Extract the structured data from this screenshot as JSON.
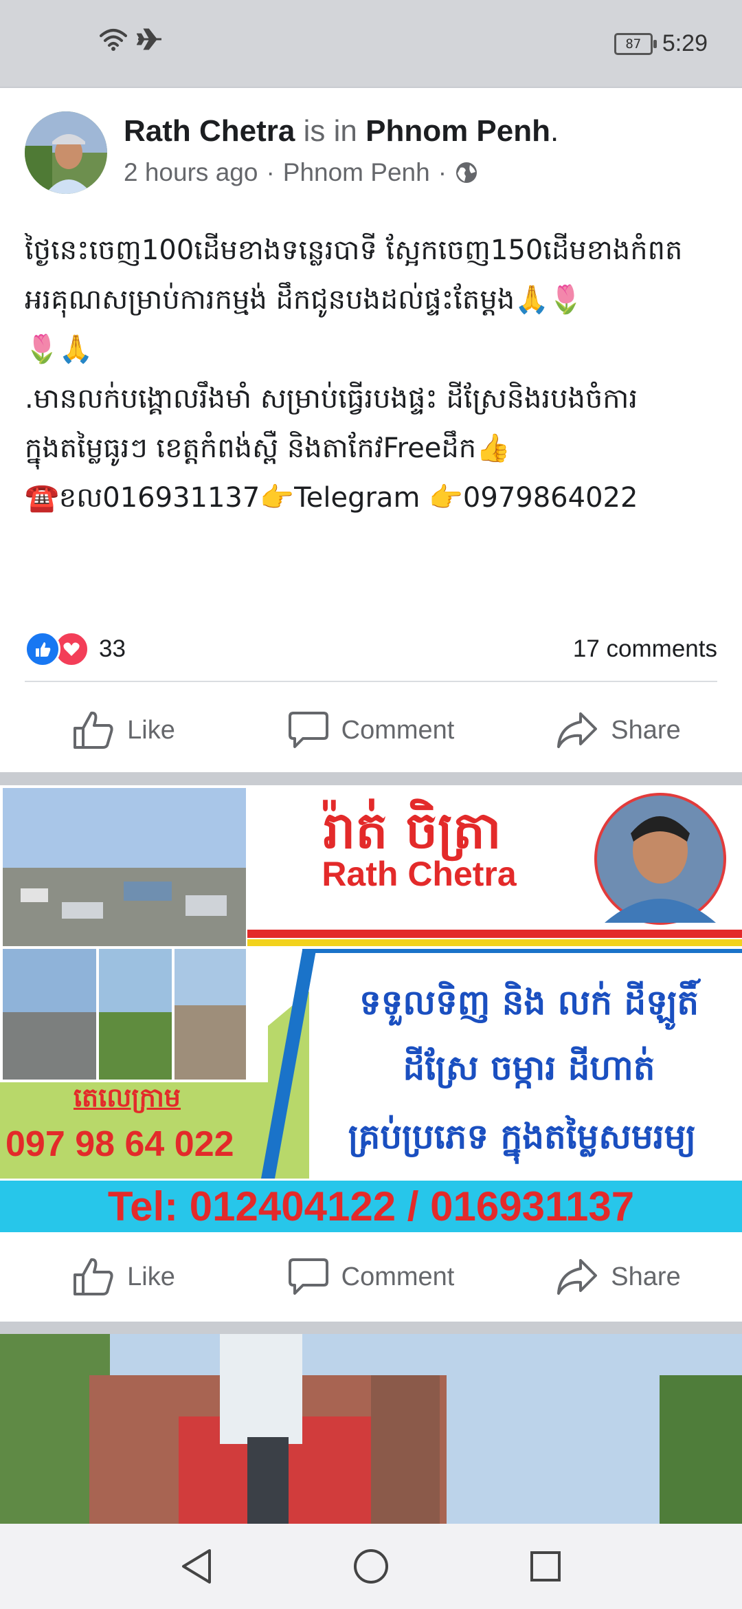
{
  "status_bar": {
    "battery": "87",
    "time": "5:29",
    "icons": [
      "wifi-icon",
      "airplane-icon"
    ]
  },
  "post": {
    "author": "Rath Chetra",
    "is_in": "is in",
    "location": "Phnom Penh",
    "period": ".",
    "time_ago": "2 hours ago",
    "separator": "·",
    "place": "Phnom Penh",
    "privacy_icon": "globe-icon",
    "text": "ថ្ងៃនេះចេញ100ដើមខាងទន្លេរបាទី ស្អែកចេញ150ដើមខាងកំពត\nអរគុណសម្រាប់ការកម្មង់ ដឹកជូនបងដល់ផ្ទះតែម្តង🙏🌷\n🌷🙏\n.មានលក់បង្គោលរឹងមាំ សម្រាប់ធ្វើរបងផ្ទះ ដីស្រែនិងរបងចំការ\nក្នុងតម្លៃធូរៗ ខេត្តកំពង់ស្ពឺ និងតាកែវFreeដឹក👍\n☎️ខល016931137👉Telegram 👉0979864022",
    "reaction_count": "33",
    "comments": "17 comments",
    "colors": {
      "like": "#1877f2",
      "love": "#f33e58"
    }
  },
  "actions": {
    "like": "Like",
    "comment": "Comment",
    "share": "Share"
  },
  "banner": {
    "khmer_name": "រ៉ាត់ ចិត្រា",
    "name": "Rath Chetra",
    "telegram_label": "តេលេក្រាម",
    "telegram_number": "097 98 64 022",
    "line1": "ទទួលទិញ និង លក់ ដីឡូតិ៍",
    "line2": "ដីស្រែ ចម្ការ ដីហាត់",
    "line3": "គ្រប់ប្រភេទ ក្នុងតម្លៃសមរម្យ",
    "tel": "Tel: 012404122 / 016931137"
  },
  "nav": {
    "icons": [
      "back-icon",
      "home-icon",
      "recents-icon"
    ]
  }
}
